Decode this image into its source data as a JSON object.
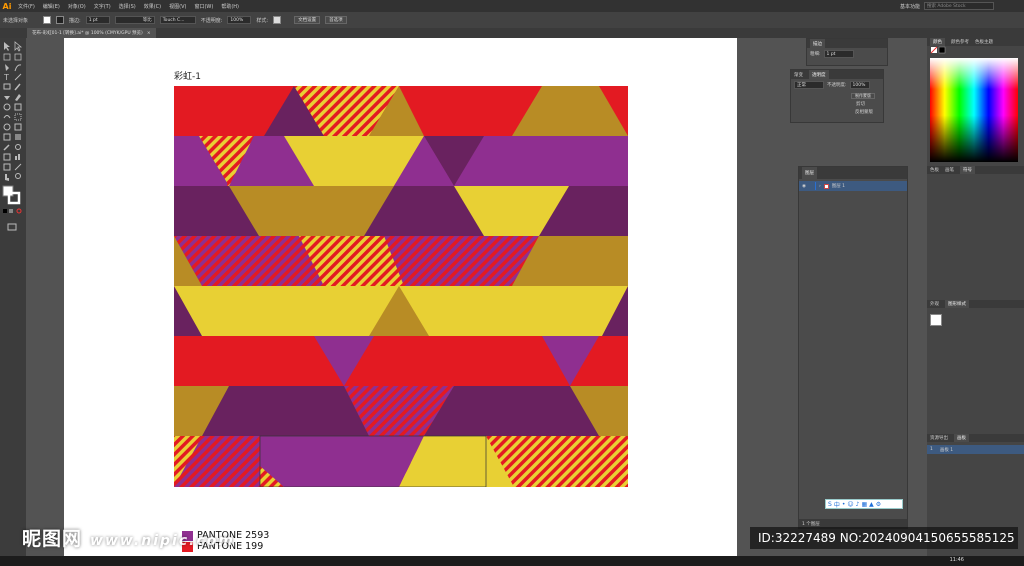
{
  "app": {
    "logo": "Ai"
  },
  "menubar": {
    "items": [
      "文件(F)",
      "编辑(E)",
      "对象(O)",
      "文字(T)",
      "选择(S)",
      "效果(C)",
      "视图(V)",
      "窗口(W)",
      "帮助(H)"
    ],
    "workspace": "基本功能",
    "search_placeholder": "搜索 Adobe Stock"
  },
  "control_bar": {
    "selection": "未选择对象",
    "stroke_label": "描边:",
    "stroke_value": "1 pt",
    "stroke_profile": "等比",
    "brush": "Touch C...",
    "opacity_label": "不透明度:",
    "opacity_value": "100%",
    "style_label": "样式:",
    "doc_setup_button": "文档设置",
    "preferences_button": "首选项"
  },
  "doc_tab": {
    "title": "花布-彩虹01-1 [转换].ai* @ 100% (CMYK/GPU 预览)",
    "close": "×"
  },
  "artboard": {
    "label": "彩虹-1"
  },
  "colors": {
    "red": "#e31a22",
    "purple": "#8f2f90",
    "plum": "#69225f",
    "mustard": "#b88c25",
    "yellow": "#e8d034"
  },
  "legend": [
    {
      "name": "PANTONE 2593",
      "color": "#8f2f90"
    },
    {
      "name": "PANTONE 199",
      "color": "#e31a22"
    }
  ],
  "stroke_panel": {
    "title": "描边",
    "weight_label": "粗细:",
    "weight_value": "1 pt"
  },
  "transparency_panel": {
    "tabs": [
      "渐变",
      "透明度"
    ],
    "blend_mode": "正常",
    "opacity_label": "不透明度:",
    "opacity_value": "100%",
    "make_mask": "制作蒙版",
    "clip": "剪切",
    "invert_mask": "反相蒙版"
  },
  "layers_panel": {
    "title": "图层",
    "layer_name": "图层 1",
    "count": "1 个图层"
  },
  "color_panel": {
    "tabs": [
      "颜色",
      "颜色参考",
      "色板主题"
    ]
  },
  "swatches_panel": {
    "tabs": [
      "色板",
      "画笔",
      "符号"
    ]
  },
  "graphic_styles_panel": {
    "tabs": [
      "外观",
      "图形样式"
    ]
  },
  "assets_panel": {
    "tabs": [
      "资源导出",
      "画板"
    ],
    "item_index": "1",
    "item_name": "画板 1"
  },
  "taskbar": {
    "time": "11:46"
  },
  "watermark": {
    "brand": "昵图网",
    "url": "www.nipic.com",
    "id_text": "ID:32227489 NO:20240904150655585125"
  }
}
